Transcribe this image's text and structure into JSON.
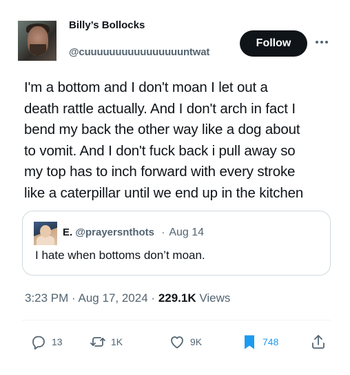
{
  "author": {
    "display_name": "Billy’s Bollocks",
    "handle": "@cuuuuuuuuuuuuuuuuntwat"
  },
  "follow_label": "Follow",
  "tweet": {
    "lines": [
      "I'm a bottom and I don't moan I let out a",
      "death rattle actually. And I don't arch in fact I",
      "bend my back the other way like a dog about",
      "to vomit. And I don't fuck back i pull away so",
      "my top has to inch forward with every stroke",
      "like a caterpillar until we end up in the kitchen"
    ]
  },
  "quote": {
    "name": "E.",
    "handle": "@prayersnthots",
    "separator": "·",
    "date": "Aug 14",
    "text": "I hate when bottoms don’t moan."
  },
  "meta": {
    "time": "3:23 PM",
    "separator": "·",
    "date": "Aug 17, 2024",
    "views_count": "229.1K",
    "views_label": "Views"
  },
  "actions": {
    "replies": "13",
    "reposts": "1K",
    "likes": "9K",
    "bookmarks": "748"
  },
  "colors": {
    "text_primary": "#0f1419",
    "text_secondary": "#536471",
    "accent_blue": "#1d9bf0",
    "border": "#cfd9de",
    "follow_bg": "#0f1419"
  },
  "icons": {
    "reply": "reply-icon",
    "repost": "repost-icon",
    "like": "heart-icon",
    "bookmark": "bookmark-icon",
    "share": "share-icon",
    "more": "more-icon"
  }
}
